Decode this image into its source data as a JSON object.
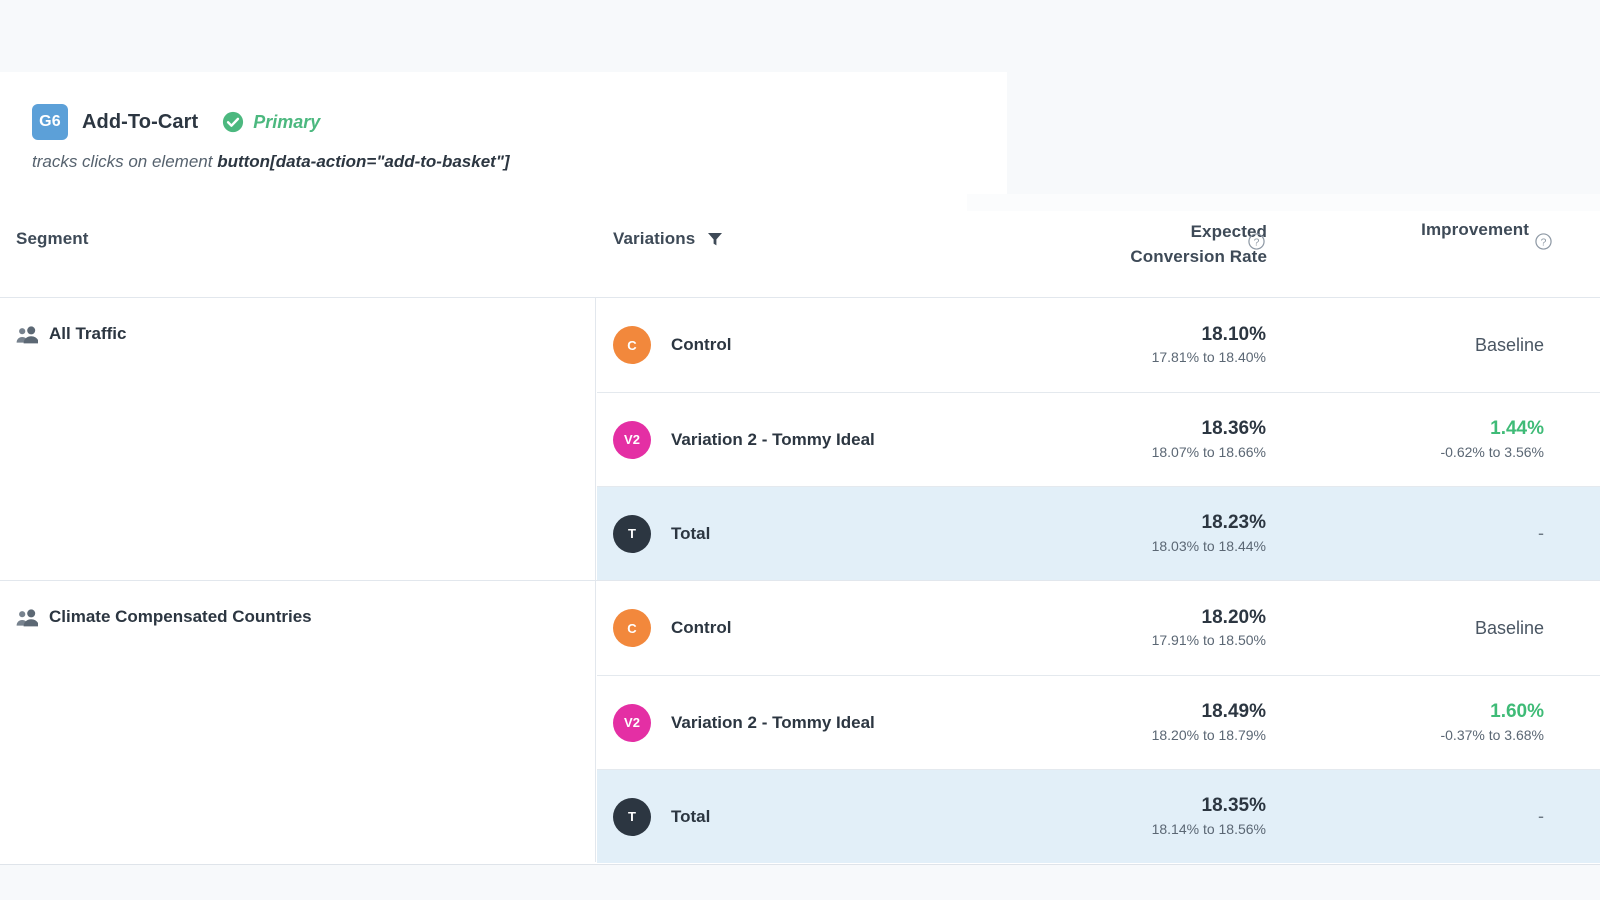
{
  "goal": {
    "badge": "G6",
    "title": "Add-To-Cart",
    "status_icon": "check-circle-icon",
    "status_label": "Primary",
    "description_prefix": "tracks clicks on element ",
    "description_selector": "button[data-action=\"add-to-basket\"]"
  },
  "colors": {
    "badge_blue": "#5ca0d8",
    "primary_green": "#4cb87f",
    "improvement_green": "#3fbb77",
    "control_orange": "#f2883c",
    "variation_magenta": "#e42fa4",
    "total_navy": "#2c3641",
    "total_row_bg": "#e2eff8"
  },
  "table": {
    "columns": {
      "segment": "Segment",
      "variations": "Variations",
      "variations_filter_icon": "filter-icon",
      "expected_cr_line1": "Expected",
      "expected_cr_line2": "Conversion Rate",
      "expected_cr_help_icon": "help-circle-icon",
      "improvement": "Improvement",
      "improvement_help_icon": "help-circle-icon"
    },
    "segments": [
      {
        "icon": "users-icon",
        "name": "All Traffic",
        "rows": [
          {
            "avatar": "C",
            "avatar_color": "#f2883c",
            "variation": "Control",
            "ecr": "18.10%",
            "ecr_ci": "17.81% to 18.40%",
            "improvement": "Baseline",
            "improvement_ci": "",
            "improvement_kind": "baseline",
            "is_total": false
          },
          {
            "avatar": "V2",
            "avatar_color": "#e42fa4",
            "variation": "Variation 2 - Tommy Ideal",
            "ecr": "18.36%",
            "ecr_ci": "18.07% to 18.66%",
            "improvement": "1.44%",
            "improvement_ci": "-0.62% to 3.56%",
            "improvement_kind": "positive",
            "is_total": false
          },
          {
            "avatar": "T",
            "avatar_color": "#2c3641",
            "variation": "Total",
            "ecr": "18.23%",
            "ecr_ci": "18.03% to 18.44%",
            "improvement": "-",
            "improvement_ci": "",
            "improvement_kind": "dash",
            "is_total": true
          }
        ]
      },
      {
        "icon": "users-icon",
        "name": "Climate Compensated Countries",
        "rows": [
          {
            "avatar": "C",
            "avatar_color": "#f2883c",
            "variation": "Control",
            "ecr": "18.20%",
            "ecr_ci": "17.91% to 18.50%",
            "improvement": "Baseline",
            "improvement_ci": "",
            "improvement_kind": "baseline",
            "is_total": false
          },
          {
            "avatar": "V2",
            "avatar_color": "#e42fa4",
            "variation": "Variation 2 - Tommy Ideal",
            "ecr": "18.49%",
            "ecr_ci": "18.20% to 18.79%",
            "improvement": "1.60%",
            "improvement_ci": "-0.37% to 3.68%",
            "improvement_kind": "positive",
            "is_total": false
          },
          {
            "avatar": "T",
            "avatar_color": "#2c3641",
            "variation": "Total",
            "ecr": "18.35%",
            "ecr_ci": "18.14% to 18.56%",
            "improvement": "-",
            "improvement_ci": "",
            "improvement_kind": "dash",
            "is_total": true
          }
        ]
      }
    ]
  }
}
